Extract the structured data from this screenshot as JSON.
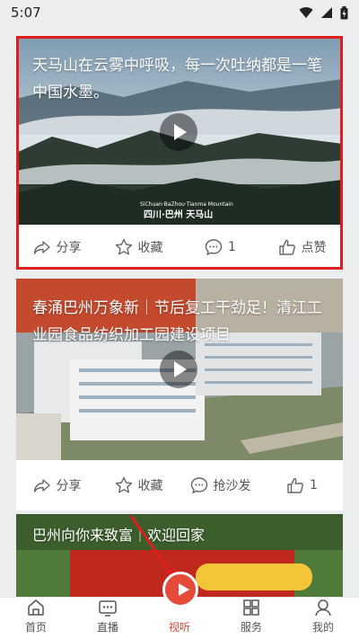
{
  "status": {
    "time": "5:07"
  },
  "feed": [
    {
      "title": "天马山在云雾中呼吸，每一次吐纳都是一笔中国水墨。",
      "location_sub": "SiChuan·BaZhou·Tianma Mountain",
      "location_main": "四川·巴州 天马山",
      "share_label": "分享",
      "fav_label": "收藏",
      "comment_label": "1",
      "like_label": "点赞"
    },
    {
      "title": "春涌巴州万象新｜节后复工干劲足！清江工业园食品纺织加工园建设项目",
      "share_label": "分享",
      "fav_label": "收藏",
      "comment_label": "抢沙发",
      "like_label": "1"
    },
    {
      "title": "巴州向你来致富｜欢迎回家"
    }
  ],
  "tabs": [
    {
      "label": "首页",
      "icon": "home-icon"
    },
    {
      "label": "直播",
      "icon": "live-icon"
    },
    {
      "label": "视听",
      "icon": "play-icon"
    },
    {
      "label": "服务",
      "icon": "grid-icon"
    },
    {
      "label": "我的",
      "icon": "profile-icon"
    }
  ],
  "colors": {
    "accent": "#e0463a",
    "highlight": "#e01e1e"
  }
}
